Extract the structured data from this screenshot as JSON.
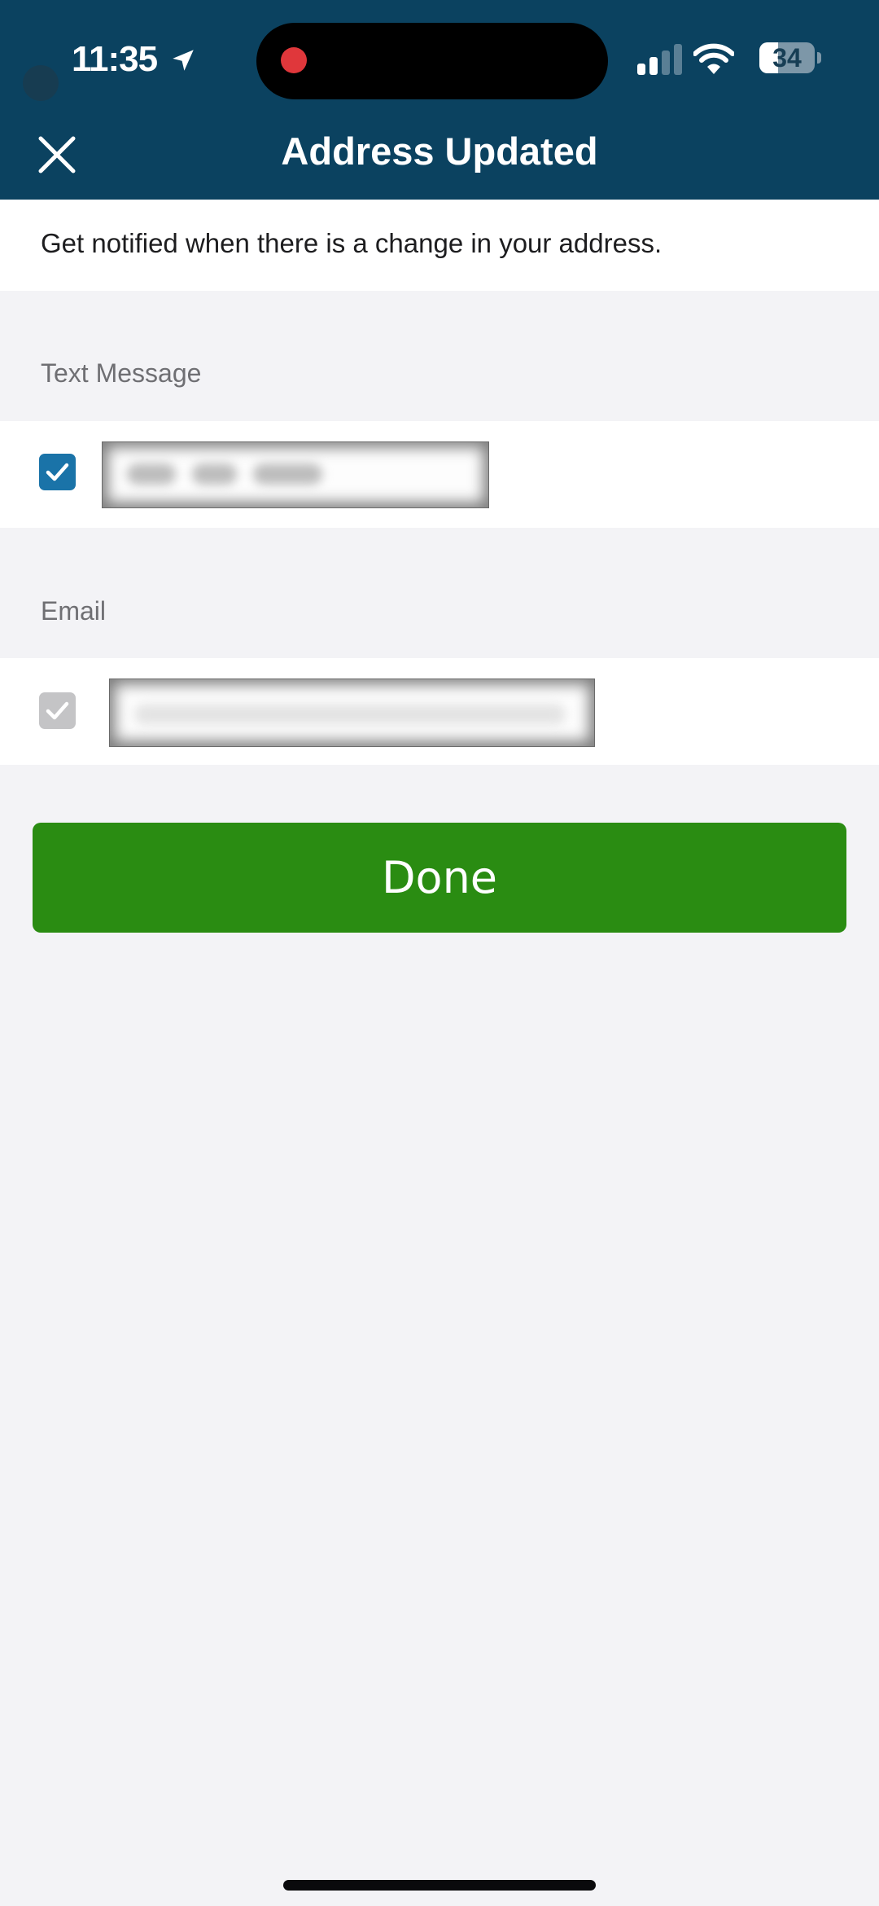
{
  "status_bar": {
    "time": "11:35",
    "battery_percent": "34",
    "battery_level": 0.34,
    "icons": [
      "location-arrow-icon",
      "recording-dot-icon",
      "signal-icon",
      "wifi-icon",
      "battery-icon"
    ]
  },
  "header": {
    "title": "Address Updated",
    "close_icon": "close-icon"
  },
  "description": "Get notified when there is a change in your address.",
  "sections": [
    {
      "label": "Text Message",
      "checked": true,
      "enabled": true,
      "value": "[redacted phone number]"
    },
    {
      "label": "Email",
      "checked": true,
      "enabled": false,
      "value": "[redacted email address]"
    }
  ],
  "done_button": {
    "label": "Done"
  },
  "colors": {
    "header_bg": "#0b4260",
    "primary_checkbox": "#1a73a8",
    "disabled_checkbox": "#c4c4c6",
    "done_button": "#2a8c12",
    "page_bg": "#f3f3f6"
  }
}
